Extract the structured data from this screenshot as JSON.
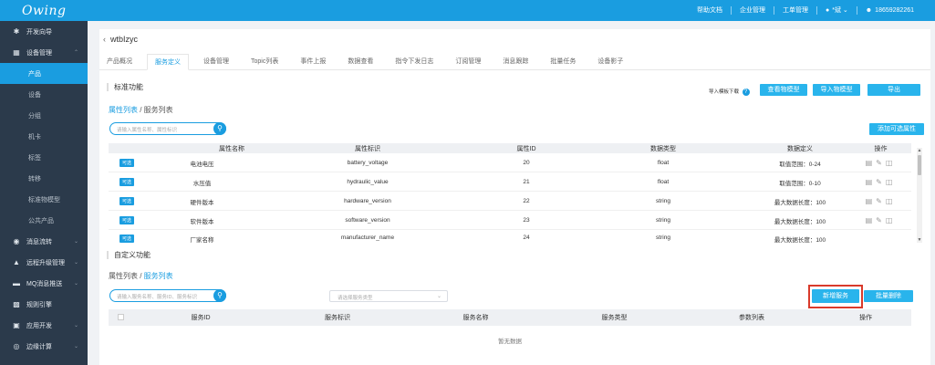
{
  "header": {
    "logo": "Owing",
    "links": [
      {
        "label": "帮助文档",
        "icon": ""
      },
      {
        "label": "企业管理",
        "icon": ""
      },
      {
        "label": "工单管理",
        "icon": ""
      },
      {
        "label": "*斌",
        "icon": "user-icon"
      },
      {
        "label": "18659282261",
        "icon": "person-icon"
      }
    ]
  },
  "sidebar": {
    "items": [
      {
        "label": "开发向导",
        "icon": "guide-icon",
        "type": "group"
      },
      {
        "label": "设备管理",
        "icon": "grid-icon",
        "type": "group",
        "caret": "⌃"
      },
      {
        "label": "产品",
        "type": "sub",
        "active": true
      },
      {
        "label": "设备",
        "type": "sub"
      },
      {
        "label": "分组",
        "type": "sub"
      },
      {
        "label": "机卡",
        "type": "sub"
      },
      {
        "label": "标签",
        "type": "sub"
      },
      {
        "label": "转移",
        "type": "sub"
      },
      {
        "label": "标准物模型",
        "type": "sub"
      },
      {
        "label": "公共产品",
        "type": "sub"
      },
      {
        "label": "消息流转",
        "icon": "flow-icon",
        "type": "group",
        "caret": "⌄"
      },
      {
        "label": "远程升级管理",
        "icon": "lock-icon",
        "type": "group",
        "caret": "⌄"
      },
      {
        "label": "MQ消息推送",
        "icon": "chat-icon",
        "type": "group",
        "caret": "⌄"
      },
      {
        "label": "规则引擎",
        "icon": "rule-icon",
        "type": "group"
      },
      {
        "label": "应用开发",
        "icon": "app-icon",
        "type": "group",
        "caret": "⌄"
      },
      {
        "label": "边缘计算",
        "icon": "edge-icon",
        "type": "group",
        "caret": "⌄"
      }
    ]
  },
  "page": {
    "back": "‹",
    "title": "wtbIzyc",
    "tabs": [
      "产品概况",
      "服务定义",
      "设备管理",
      "Topic列表",
      "事件上报",
      "数据查看",
      "指令下发日志",
      "订阅管理",
      "消息跟踪",
      "批量任务",
      "设备影子"
    ],
    "active_tab": 1
  },
  "standard": {
    "title": "标准功能",
    "crumb_link": "属性列表",
    "crumb_sep": " / ",
    "crumb_current": "服务列表",
    "search_placeholder": "请输入属性名称、属性标识",
    "import_template": "导入模板下载",
    "import_badge": "?",
    "btn_view_model": "查看物模型",
    "btn_import_model": "导入物模型",
    "btn_export": "导出",
    "btn_add_optional": "添加可选属性",
    "columns": [
      "属性名称",
      "属性标识",
      "属性ID",
      "数据类型",
      "数据定义",
      "操作"
    ],
    "rows": [
      {
        "tag": "可选",
        "name": "电池电压",
        "ident": "battery_voltage",
        "id": "20",
        "type": "float",
        "def": "取值范围：0-24"
      },
      {
        "tag": "可选",
        "name": "水压值",
        "ident": "hydraulic_value",
        "id": "21",
        "type": "float",
        "def": "取值范围：0-10"
      },
      {
        "tag": "可选",
        "name": "硬件版本",
        "ident": "hardware_version",
        "id": "22",
        "type": "string",
        "def": "最大数据长度：100"
      },
      {
        "tag": "可选",
        "name": "软件版本",
        "ident": "software_version",
        "id": "23",
        "type": "string",
        "def": "最大数据长度：100"
      },
      {
        "tag": "可选",
        "name": "厂家名称",
        "ident": "manufacturer_name",
        "id": "24",
        "type": "string",
        "def": "最大数据长度：100"
      }
    ],
    "ops_icons": [
      "edit-doc-icon",
      "pencil-icon",
      "trash-icon"
    ]
  },
  "custom": {
    "title": "自定义功能",
    "crumb_current": "属性列表",
    "crumb_sep": " / ",
    "crumb_link": "服务列表",
    "search_placeholder": "请输入服务名称、服务ID、服务标识",
    "select_placeholder": "请选择服务类型",
    "btn_add_service": "新增服务",
    "btn_batch_delete": "批量删除",
    "columns": [
      "服务ID",
      "服务标识",
      "服务名称",
      "服务类型",
      "参数列表",
      "操作"
    ],
    "empty": "暂无数据"
  },
  "colors": {
    "accent": "#1a9de0",
    "sidebar": "#2b3a4b",
    "highlight": "#d93a2b"
  }
}
